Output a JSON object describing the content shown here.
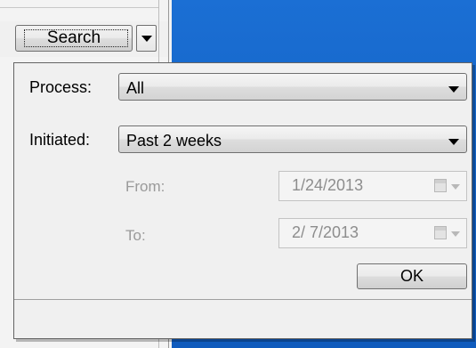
{
  "toolbar": {
    "search_label": "Search"
  },
  "filter": {
    "process_label": "Process:",
    "process_value": "All",
    "initiated_label": "Initiated:",
    "initiated_value": "Past 2 weeks",
    "from_label": "From:",
    "from_value": "1/24/2013",
    "to_label": "To:",
    "to_value": "2/ 7/2013",
    "ok_label": "OK"
  },
  "colors": {
    "desktop_blue": "#1565c8",
    "panel_bg": "#f0f0f0",
    "disabled_text": "#9a9a9a"
  }
}
